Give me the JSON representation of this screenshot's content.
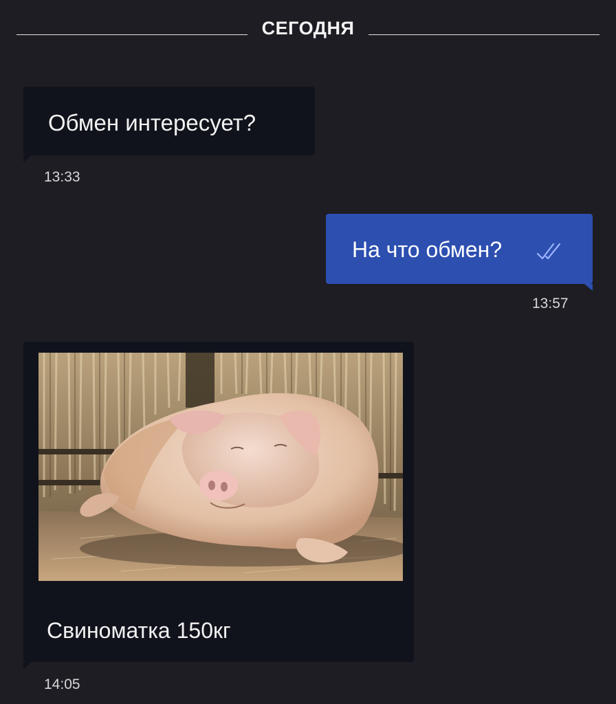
{
  "date_divider": {
    "label": "СЕГОДНЯ"
  },
  "messages": [
    {
      "direction": "incoming",
      "text": "Обмен интересует?",
      "time": "13:33"
    },
    {
      "direction": "outgoing",
      "text": "На что обмен?",
      "time": "13:57",
      "status_icon": "double-check-icon"
    },
    {
      "direction": "incoming",
      "type": "photo",
      "photo_subject": "pig-photo",
      "caption": "Свиноматка 150кг",
      "time": "14:05"
    }
  ],
  "colors": {
    "background": "#1d1d23",
    "incoming_bubble": "#11131c",
    "outgoing_bubble": "#2c4fb0",
    "check_marks": "#9db4ff"
  }
}
